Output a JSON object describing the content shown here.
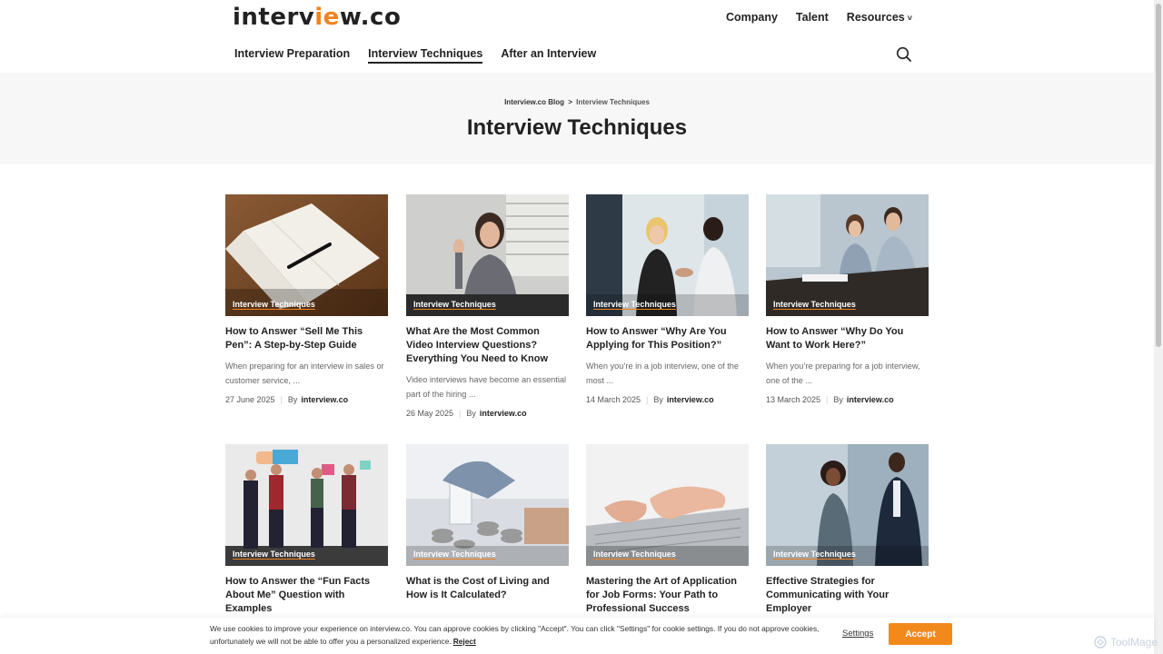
{
  "header": {
    "logo_main": "interv",
    "logo_accent": "ie",
    "logo_tail": "w.co",
    "top_nav": [
      "Company",
      "Talent",
      "Resources"
    ],
    "sub_nav": [
      "Interview Preparation",
      "Interview Techniques",
      "After an Interview"
    ],
    "active_sub_nav": "Interview Techniques"
  },
  "hero": {
    "breadcrumb_home": "Interview.co Blog",
    "breadcrumb_sep": ">",
    "breadcrumb_current": "Interview Techniques",
    "title": "Interview Techniques"
  },
  "posts": [
    {
      "category": "Interview Techniques",
      "title": "How to Answer “Sell Me This Pen”: A Step-by-Step Guide",
      "excerpt": "When preparing for an interview in sales or customer service, ...",
      "date": "27 June 2025",
      "by": "By",
      "author": "interview.co",
      "image": "notebook-pen"
    },
    {
      "category": "Interview Techniques",
      "title": "What Are the Most Common Video Interview Questions? Everything You Need to Know",
      "excerpt": "Video interviews have become an essential part of the hiring ...",
      "date": "26 May 2025",
      "by": "By",
      "author": "interview.co",
      "image": "woman-waving-video-call"
    },
    {
      "category": "Interview Techniques",
      "title": "How to Answer “Why Are You Applying for This Position?”",
      "excerpt": "When you’re in a job interview, one of the most ...",
      "date": "14 March 2025",
      "by": "By",
      "author": "interview.co",
      "image": "handshake-interview"
    },
    {
      "category": "Interview Techniques",
      "title": "How to Answer “Why Do You Want to Work Here?”",
      "excerpt": "When you’re preparing for a job interview, one of the ...",
      "date": "13 March 2025",
      "by": "By",
      "author": "interview.co",
      "image": "office-meeting"
    },
    {
      "category": "Interview Techniques",
      "title": "How to Answer the “Fun Facts About Me” Question with Examples",
      "image": "people-speech-bubbles"
    },
    {
      "category": "Interview Techniques",
      "title": "What is the Cost of Living and How is It Calculated?",
      "image": "coins-jar"
    },
    {
      "category": "Interview Techniques",
      "title": "Mastering the Art of Application for Job Forms: Your Path to Professional Success",
      "image": "laptop-typing"
    },
    {
      "category": "Interview Techniques",
      "title": "Effective Strategies for Communicating with Your Employer",
      "image": "colleagues-talking"
    }
  ],
  "cookie": {
    "text": "We use cookies to improve your experience on interview.co. You can approve cookies by clicking \"Accept\". You can click \"Settings\" for cookie settings. If you do not approve cookies, unfortunately we will not be able to offer you a personalized experience.",
    "reject": "Reject",
    "settings": "Settings",
    "accept": "Accept"
  },
  "watermark": "ToolMage",
  "colors": {
    "accent": "#f0821e",
    "button": "#f28a1b",
    "hero_bg": "#f7f7f7"
  }
}
